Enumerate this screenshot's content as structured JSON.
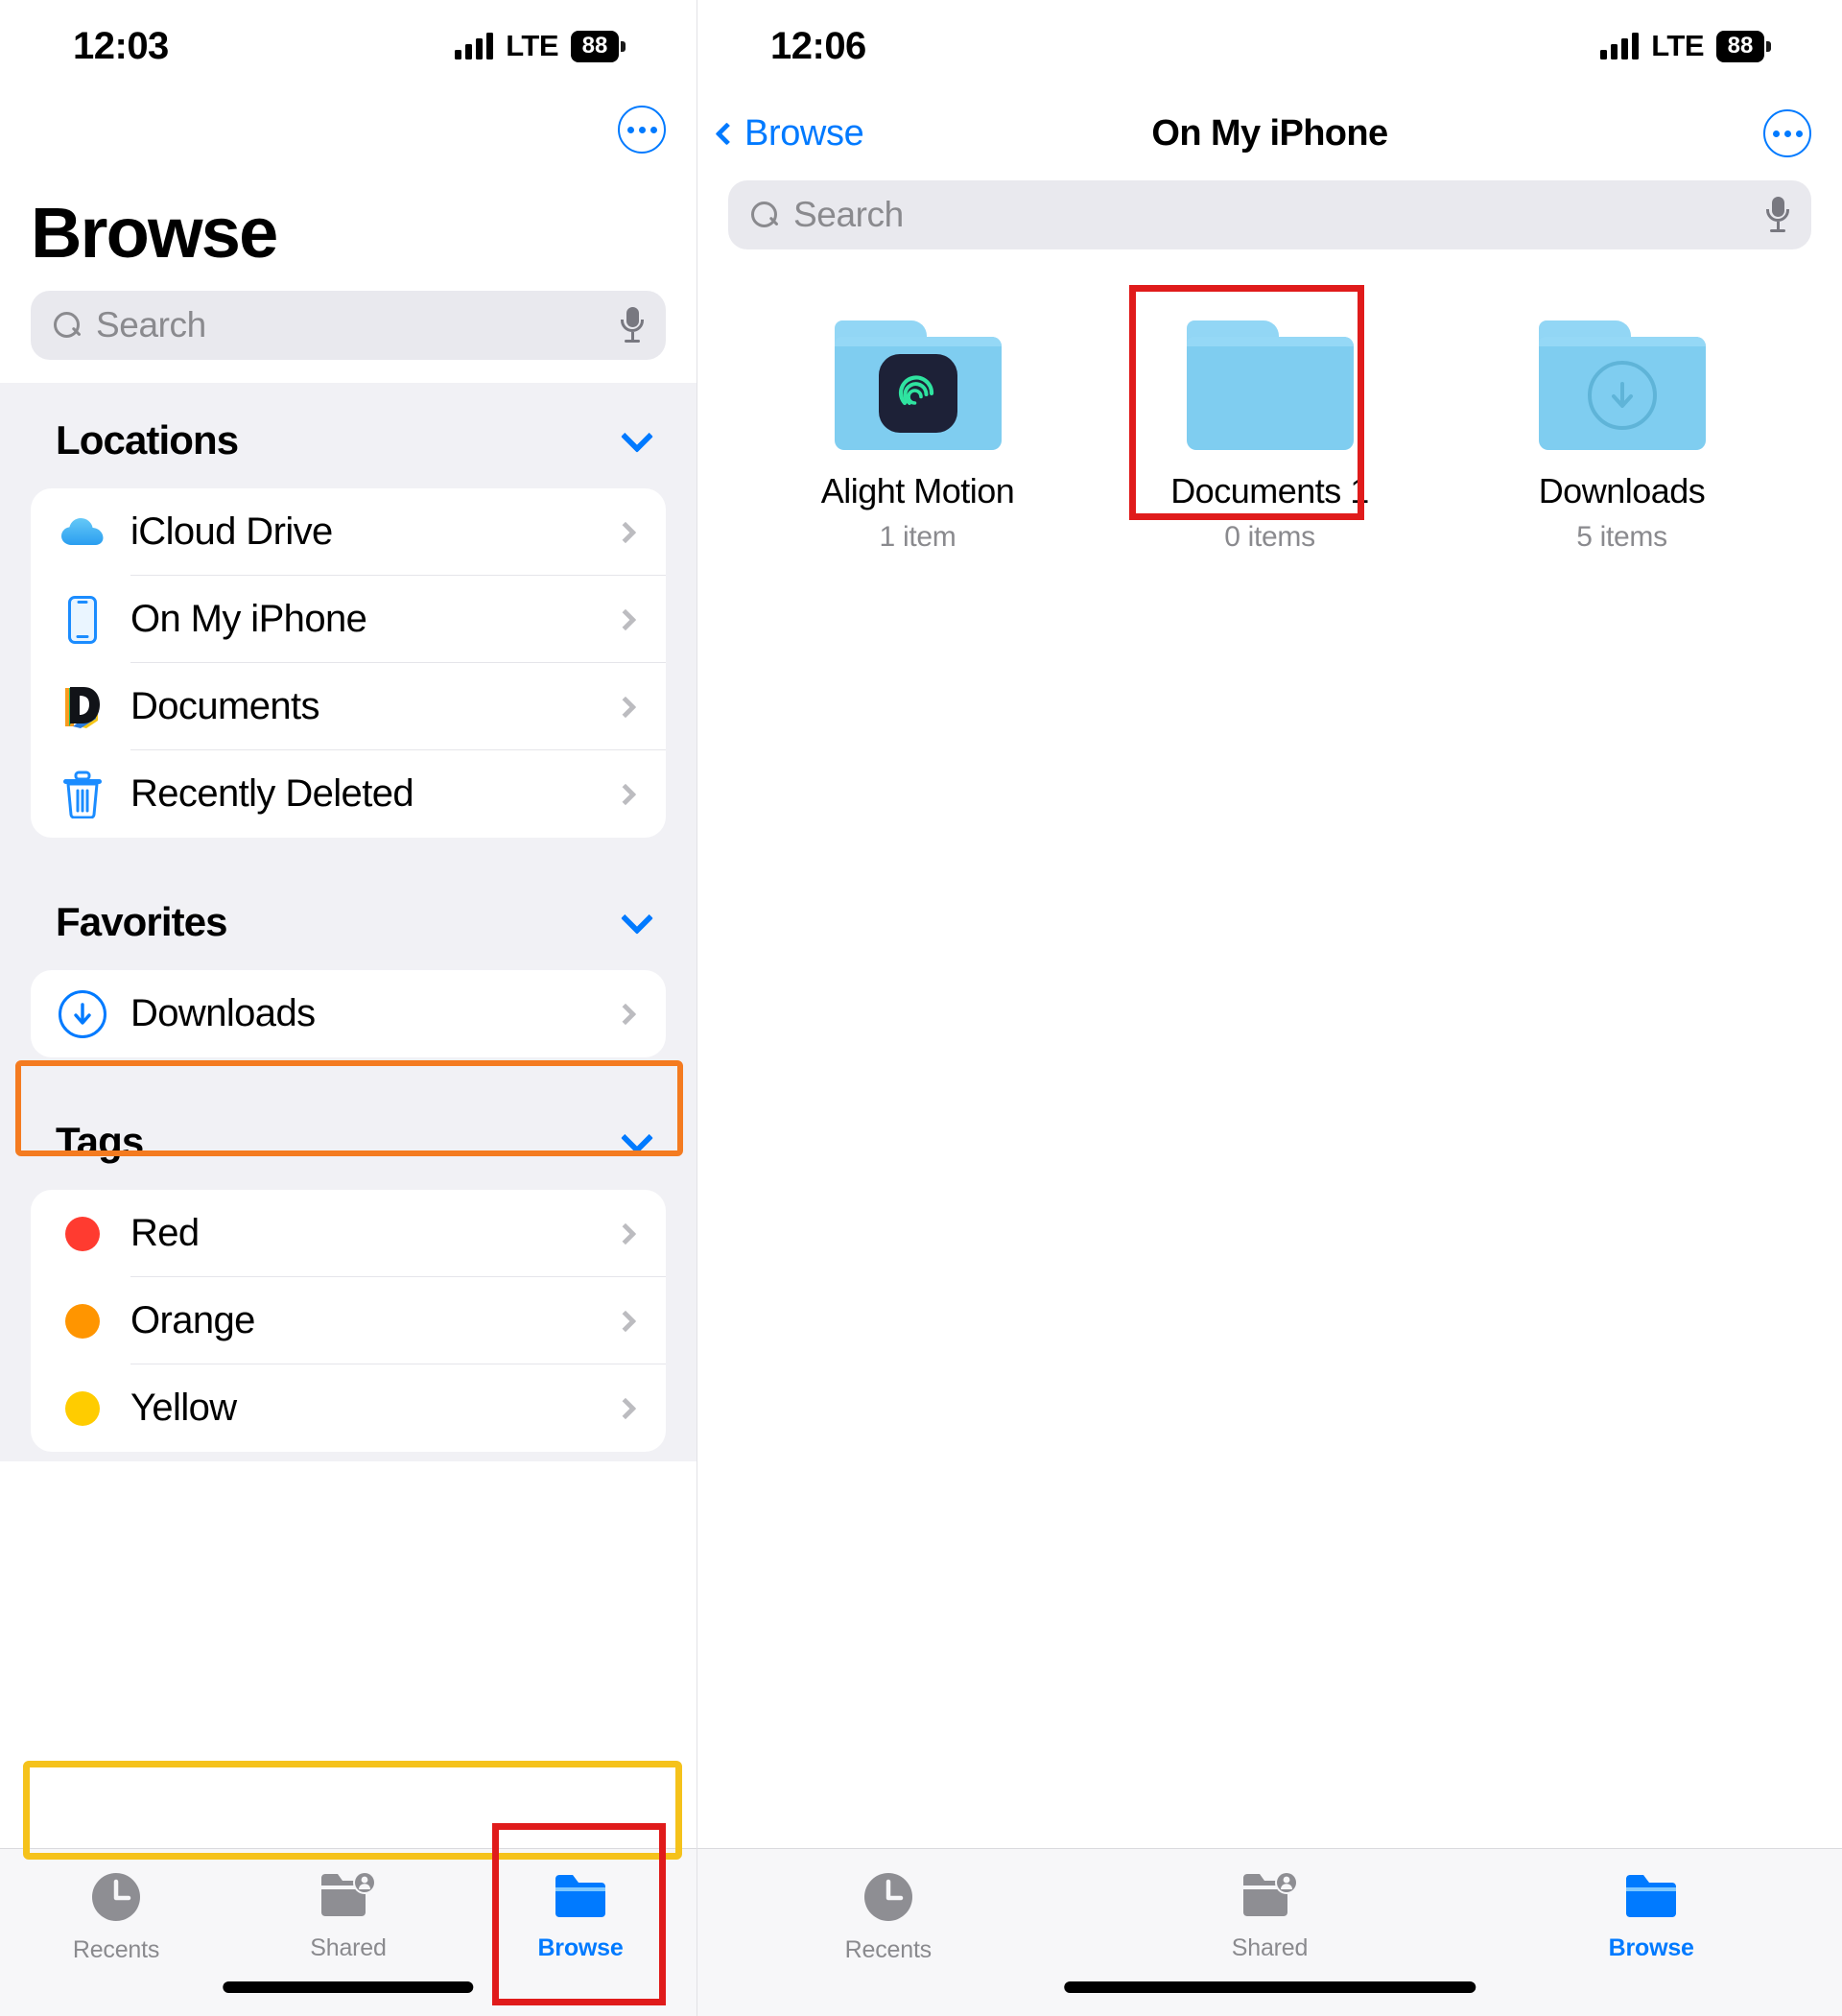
{
  "left": {
    "status": {
      "time": "12:03",
      "network": "LTE",
      "battery": "88"
    },
    "more_button": "more-options",
    "title": "Browse",
    "search": {
      "placeholder": "Search"
    },
    "sections": [
      {
        "header": "Locations",
        "items": [
          {
            "label": "iCloud Drive",
            "icon": "icloud-icon"
          },
          {
            "label": "On My iPhone",
            "icon": "iphone-icon",
            "highlight": "orange"
          },
          {
            "label": "Documents",
            "icon": "documents-app-icon"
          },
          {
            "label": "Recently Deleted",
            "icon": "trash-icon"
          }
        ]
      },
      {
        "header": "Favorites",
        "items": [
          {
            "label": "Downloads",
            "icon": "download-circle-icon",
            "highlight": "yellow"
          }
        ]
      },
      {
        "header": "Tags",
        "items": [
          {
            "label": "Red",
            "icon": "tag-dot-icon",
            "color": "#ff3b30"
          },
          {
            "label": "Orange",
            "icon": "tag-dot-icon",
            "color": "#ff9500"
          },
          {
            "label": "Yellow",
            "icon": "tag-dot-icon",
            "color": "#ffcc00"
          }
        ]
      }
    ],
    "tabs": [
      {
        "label": "Recents",
        "icon": "clock-icon",
        "active": false
      },
      {
        "label": "Shared",
        "icon": "shared-folder-icon",
        "active": false
      },
      {
        "label": "Browse",
        "icon": "folder-icon",
        "active": true,
        "highlight": "red"
      }
    ]
  },
  "right": {
    "status": {
      "time": "12:06",
      "network": "LTE",
      "battery": "88"
    },
    "nav": {
      "back_label": "Browse",
      "title": "On My iPhone",
      "more_button": "more-options"
    },
    "search": {
      "placeholder": "Search"
    },
    "folders": [
      {
        "name": "Alight Motion",
        "count": "1 item",
        "icon": "alight-motion-app-icon"
      },
      {
        "name": "Documents 1",
        "count": "0 items",
        "icon": "plain-folder-icon"
      },
      {
        "name": "Downloads",
        "count": "5 items",
        "icon": "download-circle-icon",
        "highlight": "red"
      }
    ],
    "tabs": [
      {
        "label": "Recents",
        "icon": "clock-icon",
        "active": false
      },
      {
        "label": "Shared",
        "icon": "shared-folder-icon",
        "active": false
      },
      {
        "label": "Browse",
        "icon": "folder-icon",
        "active": true
      }
    ]
  },
  "colors": {
    "accent_blue": "#007aff",
    "highlight_orange": "#f47b20",
    "highlight_yellow": "#f5c21b",
    "highlight_red": "#e01b1b",
    "folder_blue": "#7fcdf0",
    "muted_gray": "#8a8a8e"
  }
}
